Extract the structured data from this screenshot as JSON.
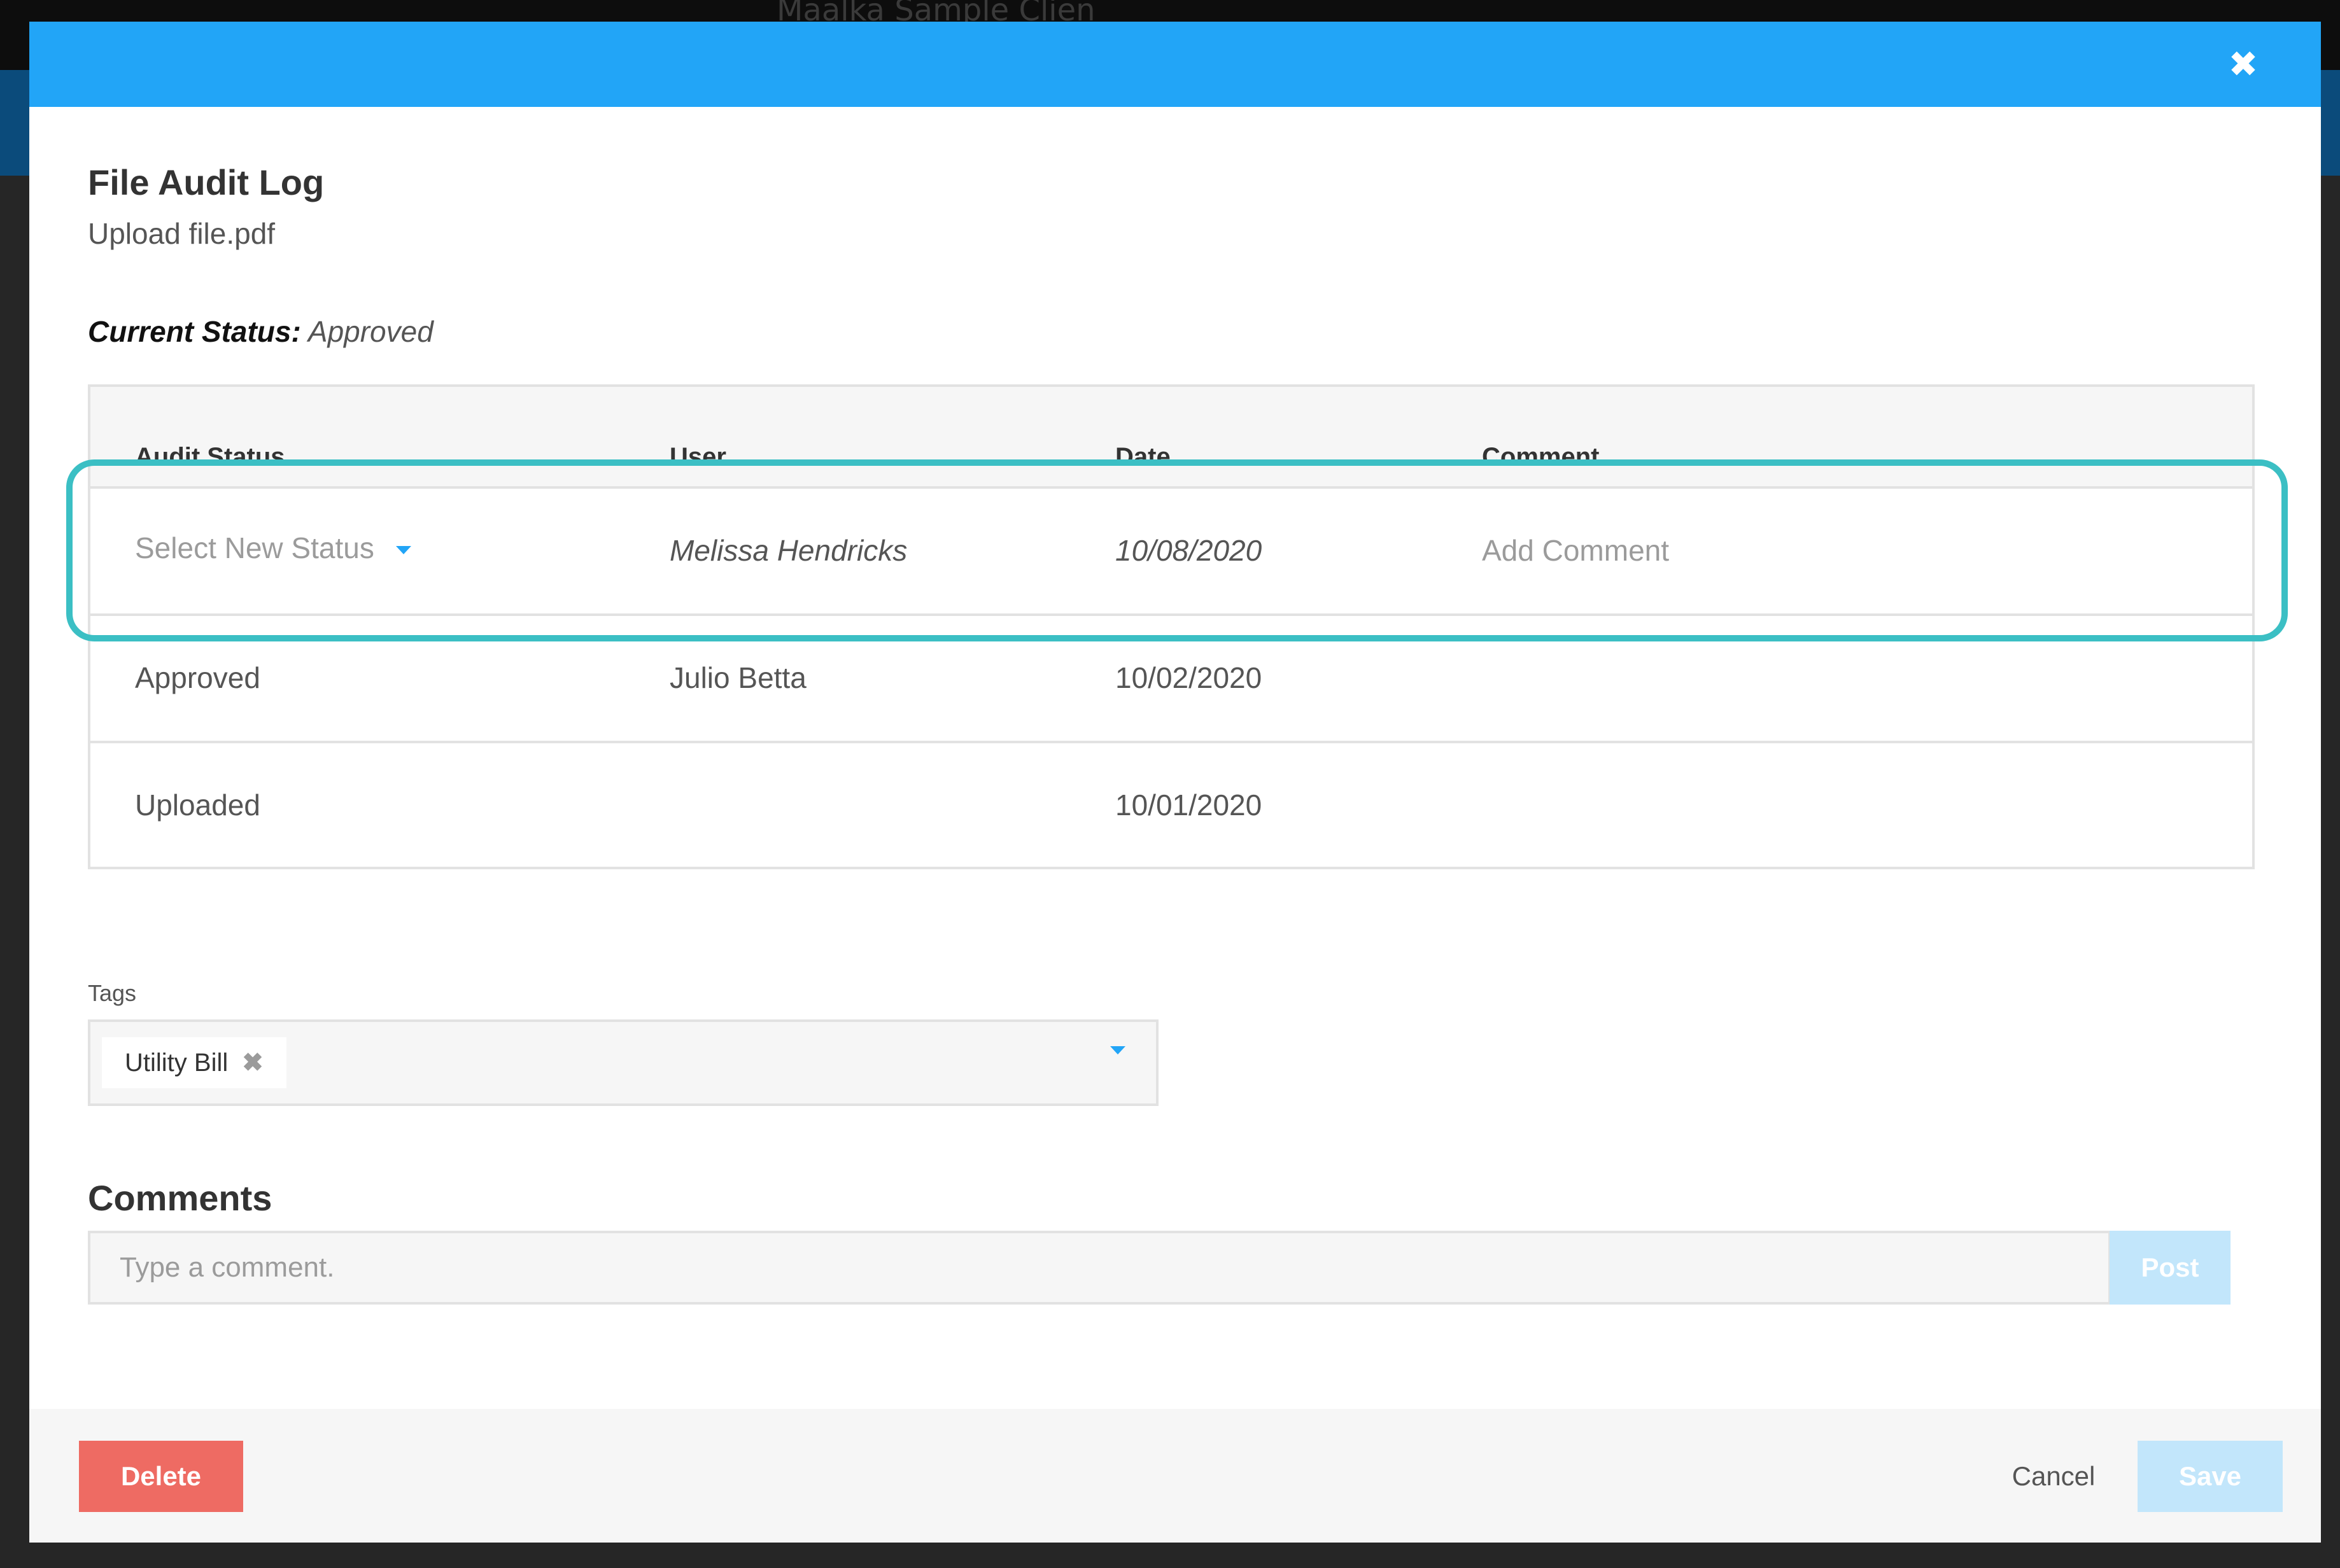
{
  "background": {
    "client_name": "Maalka Sample Client"
  },
  "modal": {
    "close_icon": "close-icon",
    "title": "File Audit Log",
    "subtitle": "Upload file.pdf",
    "current_status_label": "Current Status:",
    "current_status_value": "Approved"
  },
  "audit_table": {
    "headers": [
      "Audit Status",
      "User",
      "Date",
      "Comment"
    ],
    "new_entry": {
      "status_placeholder": "Select New Status",
      "user": "Melissa Hendricks",
      "date": "10/08/2020",
      "comment_placeholder": "Add Comment"
    },
    "rows": [
      {
        "status": "Approved",
        "user": "Julio Betta",
        "date": "10/02/2020",
        "comment": ""
      },
      {
        "status": "Uploaded",
        "user": "",
        "date": "10/01/2020",
        "comment": ""
      }
    ]
  },
  "tags": {
    "label": "Tags",
    "selected": [
      "Utility Bill"
    ],
    "remove_icon": "remove-tag-icon"
  },
  "comments": {
    "heading": "Comments",
    "placeholder": "Type a comment.",
    "post_label": "Post"
  },
  "footer": {
    "delete_label": "Delete",
    "cancel_label": "Cancel",
    "save_label": "Save"
  },
  "colors": {
    "header": "#22a5f7",
    "highlight": "#3bbfc4",
    "delete": "#ee6b63",
    "disabled_primary": "#c2e6fb"
  }
}
